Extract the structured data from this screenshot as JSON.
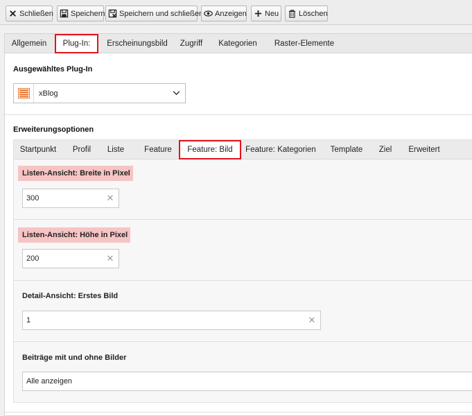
{
  "toolbar": {
    "buttons": [
      {
        "icon": "close-icon",
        "label": "Schließen"
      },
      {
        "icon": "save-icon",
        "label": "Speichern"
      },
      {
        "icon": "save-close-icon",
        "label": "Speichern und schließen"
      },
      {
        "icon": "eye-icon",
        "label": "Anzeigen"
      },
      {
        "icon": "plus-icon",
        "label": "Neu"
      },
      {
        "icon": "trash-icon",
        "label": "Löschen"
      }
    ]
  },
  "main_tabs": [
    "Allgemein",
    "Plug-In:",
    "Erscheinungsbild",
    "Zugriff",
    "Kategorien",
    "Raster-Elemente"
  ],
  "main_active_tab": "Plug-In:",
  "plugin": {
    "section_title": "Ausgewähltes Plug-In",
    "selected": "xBlog",
    "icon": "list-icon",
    "icon_color": "#e9712a"
  },
  "extensions": {
    "section_title": "Erweiterungsoptionen",
    "tabs": [
      "Startpunkt",
      "Profil",
      "Liste",
      "Feature",
      "Feature: Bild",
      "Feature: Kategorien",
      "Template",
      "Ziel",
      "Erweitert"
    ],
    "active_tab": "Feature: Bild",
    "fields": [
      {
        "label": "Listen-Ansicht: Breite in Pixel",
        "value": "300",
        "highlight": true
      },
      {
        "label": "Listen-Ansicht: Höhe in Pixel",
        "value": "200",
        "highlight": true
      },
      {
        "label": "Detail-Ansicht: Erstes Bild",
        "value": "1",
        "highlight": false
      },
      {
        "label": "Beiträge mit und ohne Bilder",
        "value": "Alle anzeigen",
        "highlight": false
      }
    ]
  },
  "colors": {
    "active_tab_border": "#e3121b",
    "required_label_bg": "#f6c4c4"
  }
}
